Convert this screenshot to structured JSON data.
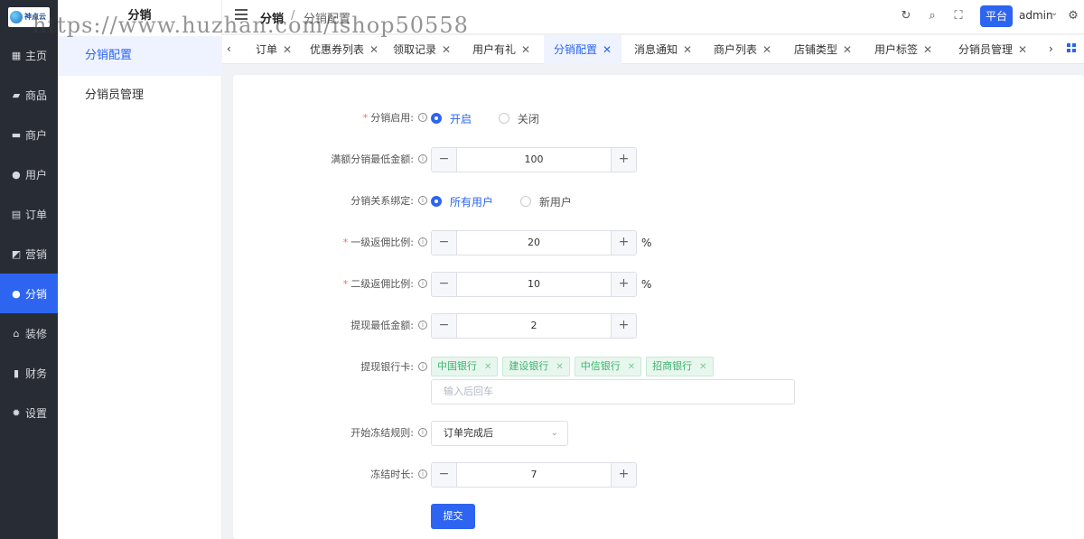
{
  "app": {
    "logo_text": "神点云"
  },
  "sidebar": {
    "items": [
      {
        "label": "主页",
        "icon": "grid-icon"
      },
      {
        "label": "商品",
        "icon": "bag-icon"
      },
      {
        "label": "商户",
        "icon": "store-icon"
      },
      {
        "label": "用户",
        "icon": "user-icon"
      },
      {
        "label": "订单",
        "icon": "clipboard-icon"
      },
      {
        "label": "营销",
        "icon": "chart-icon"
      },
      {
        "label": "分销",
        "icon": "user-share-icon",
        "active": true
      },
      {
        "label": "装修",
        "icon": "home-icon"
      },
      {
        "label": "财务",
        "icon": "finance-icon"
      },
      {
        "label": "设置",
        "icon": "gear-icon"
      }
    ]
  },
  "submenu": {
    "title": "分销",
    "items": [
      {
        "label": "分销配置",
        "active": true
      },
      {
        "label": "分销员管理"
      }
    ]
  },
  "header": {
    "breadcrumb_root": "分销",
    "breadcrumb_sep": "/",
    "breadcrumb_current": "分销配置",
    "platform_label": "平台",
    "user_name": "admin"
  },
  "tabs": [
    {
      "label": "订单"
    },
    {
      "label": "优惠券列表"
    },
    {
      "label": "领取记录"
    },
    {
      "label": "用户有礼"
    },
    {
      "label": "分销配置",
      "active": true
    },
    {
      "label": "消息通知"
    },
    {
      "label": "商户列表"
    },
    {
      "label": "店铺类型"
    },
    {
      "label": "用户标签"
    },
    {
      "label": "分销员管理"
    }
  ],
  "form": {
    "enable": {
      "label": "分销启用:",
      "required": true,
      "options": [
        "开启",
        "关闭"
      ],
      "selected": "开启"
    },
    "min_amount": {
      "label": "满额分销最低金额:",
      "value": "100"
    },
    "binding": {
      "label": "分销关系绑定:",
      "options": [
        "所有用户",
        "新用户"
      ],
      "selected": "所有用户"
    },
    "level1": {
      "label": "一级返佣比例:",
      "required": true,
      "value": "20",
      "suffix": "%"
    },
    "level2": {
      "label": "二级返佣比例:",
      "required": true,
      "value": "10",
      "suffix": "%"
    },
    "withdraw_min": {
      "label": "提现最低金额:",
      "value": "2"
    },
    "bank_cards": {
      "label": "提现银行卡:",
      "tags": [
        "中国银行",
        "建设银行",
        "中信银行",
        "招商银行"
      ],
      "placeholder": "输入后回车"
    },
    "freeze_rule": {
      "label": "开始冻结规则:",
      "value": "订单完成后"
    },
    "freeze_time": {
      "label": "冻结时长:",
      "value": "7"
    },
    "submit_label": "提交"
  },
  "watermark": "https://www.huzhan.com/ishop50558",
  "colors": {
    "primary": "#2d64f0",
    "sidebar_bg": "#282c34",
    "tag_green": "#3bb36b"
  }
}
